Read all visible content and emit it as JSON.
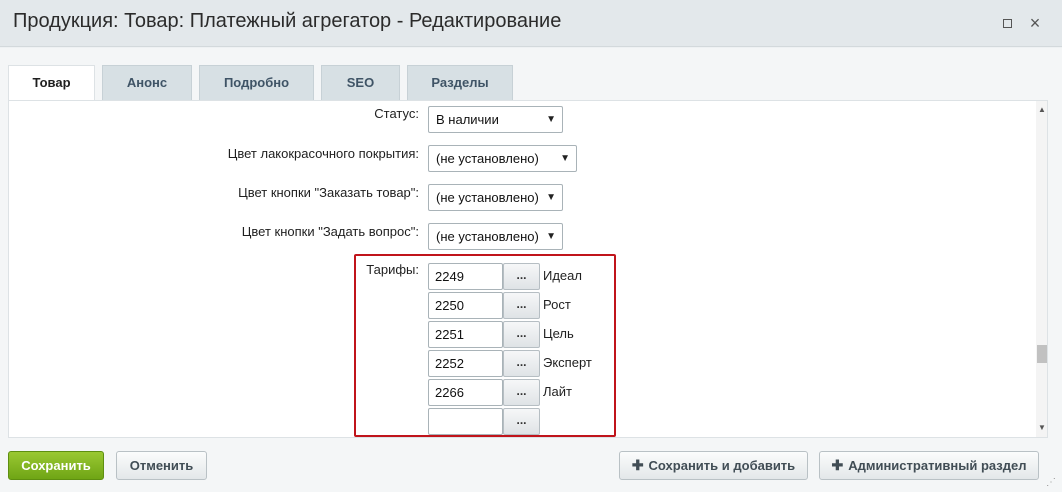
{
  "window": {
    "title": "Продукция: Товар: Платежный агрегатор - Редактирование",
    "maximize_icon": "maximize-icon",
    "close_glyph": "×"
  },
  "tabs": [
    {
      "label": "Товар",
      "active": true
    },
    {
      "label": "Анонс",
      "active": false
    },
    {
      "label": "Подробно",
      "active": false
    },
    {
      "label": "SEO",
      "active": false
    },
    {
      "label": "Разделы",
      "active": false
    }
  ],
  "form": {
    "status": {
      "label": "Статус:",
      "value": "В наличии"
    },
    "paint_color": {
      "label": "Цвет лакокрасочного покрытия:",
      "value": "(не установлено)"
    },
    "order_button_color": {
      "label": "Цвет кнопки \"Заказать товар\":",
      "value": "(не установлено)"
    },
    "ask_button_color": {
      "label": "Цвет кнопки \"Задать вопрос\":",
      "value": "(не установлено)"
    },
    "tariffs": {
      "label": "Тарифы:",
      "dots_label": "...",
      "items": [
        {
          "id": "2249",
          "name": "Идеал"
        },
        {
          "id": "2250",
          "name": "Рост"
        },
        {
          "id": "2251",
          "name": "Цель"
        },
        {
          "id": "2252",
          "name": "Эксперт"
        },
        {
          "id": "2266",
          "name": "Лайт"
        },
        {
          "id": "",
          "name": ""
        }
      ]
    }
  },
  "buttons": {
    "save": "Сохранить",
    "cancel": "Отменить",
    "save_and_add": "Сохранить и добавить",
    "admin_section": "Административный раздел"
  },
  "colors": {
    "highlight": "#c0141b",
    "save_button": "#7fb221"
  }
}
